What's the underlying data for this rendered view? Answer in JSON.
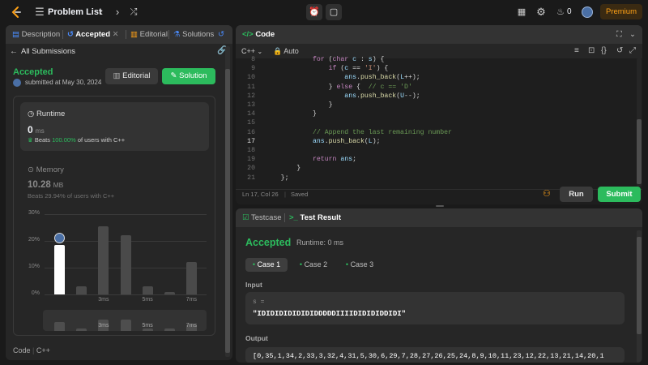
{
  "header": {
    "title": "Problem List",
    "notifications": "0",
    "premium": "Premium"
  },
  "left": {
    "tabs": [
      {
        "label": "Description"
      },
      {
        "label": "Accepted"
      },
      {
        "label": "Editorial"
      },
      {
        "label": "Solutions"
      }
    ],
    "back_label": "All Submissions",
    "status": "Accepted",
    "submitted": "submitted at May 30, 2024",
    "editorial_btn": "Editorial",
    "solution_btn": "Solution",
    "runtime": {
      "label": "Runtime",
      "value": "0",
      "unit": "ms",
      "beats_prefix": "Beats",
      "beats_pct": "100.00%",
      "beats_suffix": "of users with C++"
    },
    "memory": {
      "label": "Memory",
      "value": "10.28",
      "unit": "MB",
      "beats": "Beats 29.94% of users with C++"
    },
    "footer": {
      "code": "Code",
      "lang": "C++"
    }
  },
  "chart_data": {
    "type": "bar",
    "y_ticks": [
      "30%",
      "20%",
      "10%",
      "0%"
    ],
    "ylim": [
      0,
      30
    ],
    "x_ticks": [
      "3ms",
      "5ms",
      "7ms"
    ],
    "values": [
      18.5,
      3,
      25.5,
      22,
      3,
      1,
      12
    ],
    "highlight_index": 0,
    "mini_values": [
      4,
      1,
      5,
      5,
      1,
      1,
      3
    ],
    "mini_x_ticks": [
      "3ms",
      "5ms",
      "7ms"
    ]
  },
  "code": {
    "title": "Code",
    "lang": "C++",
    "mode": "Auto",
    "status": "Ln 17, Col 26",
    "saved": "Saved",
    "run_btn": "Run",
    "submit_btn": "Submit",
    "lines": [
      {
        "n": "8",
        "t": "            for (char c : s) {"
      },
      {
        "n": "9",
        "t": "                if (c == 'I') {"
      },
      {
        "n": "10",
        "t": "                    ans.push_back(L++);"
      },
      {
        "n": "11",
        "t": "                } else {  // c == 'D'"
      },
      {
        "n": "12",
        "t": "                    ans.push_back(U--);"
      },
      {
        "n": "13",
        "t": "                }"
      },
      {
        "n": "14",
        "t": "            }"
      },
      {
        "n": "15",
        "t": ""
      },
      {
        "n": "16",
        "t": "            // Append the last remaining number"
      },
      {
        "n": "17",
        "t": "            ans.push_back(L);"
      },
      {
        "n": "18",
        "t": ""
      },
      {
        "n": "19",
        "t": "            return ans;"
      },
      {
        "n": "20",
        "t": "        }"
      },
      {
        "n": "21",
        "t": "    };"
      }
    ]
  },
  "result": {
    "tabs": [
      {
        "label": "Testcase"
      },
      {
        "label": "Test Result"
      }
    ],
    "status": "Accepted",
    "runtime": "Runtime: 0 ms",
    "cases": [
      "Case 1",
      "Case 2",
      "Case 3"
    ],
    "input_label": "Input",
    "input_var": "s =",
    "input_value": "\"IDIDIDIDIDIDIDDDDDIIIIDIDIDIDDIDI\"",
    "output_label": "Output",
    "output_value": "[0,35,1,34,2,33,3,32,4,31,5,30,6,29,7,28,27,26,25,24,8,9,10,11,23,12,22,13,21,14,20,1"
  }
}
